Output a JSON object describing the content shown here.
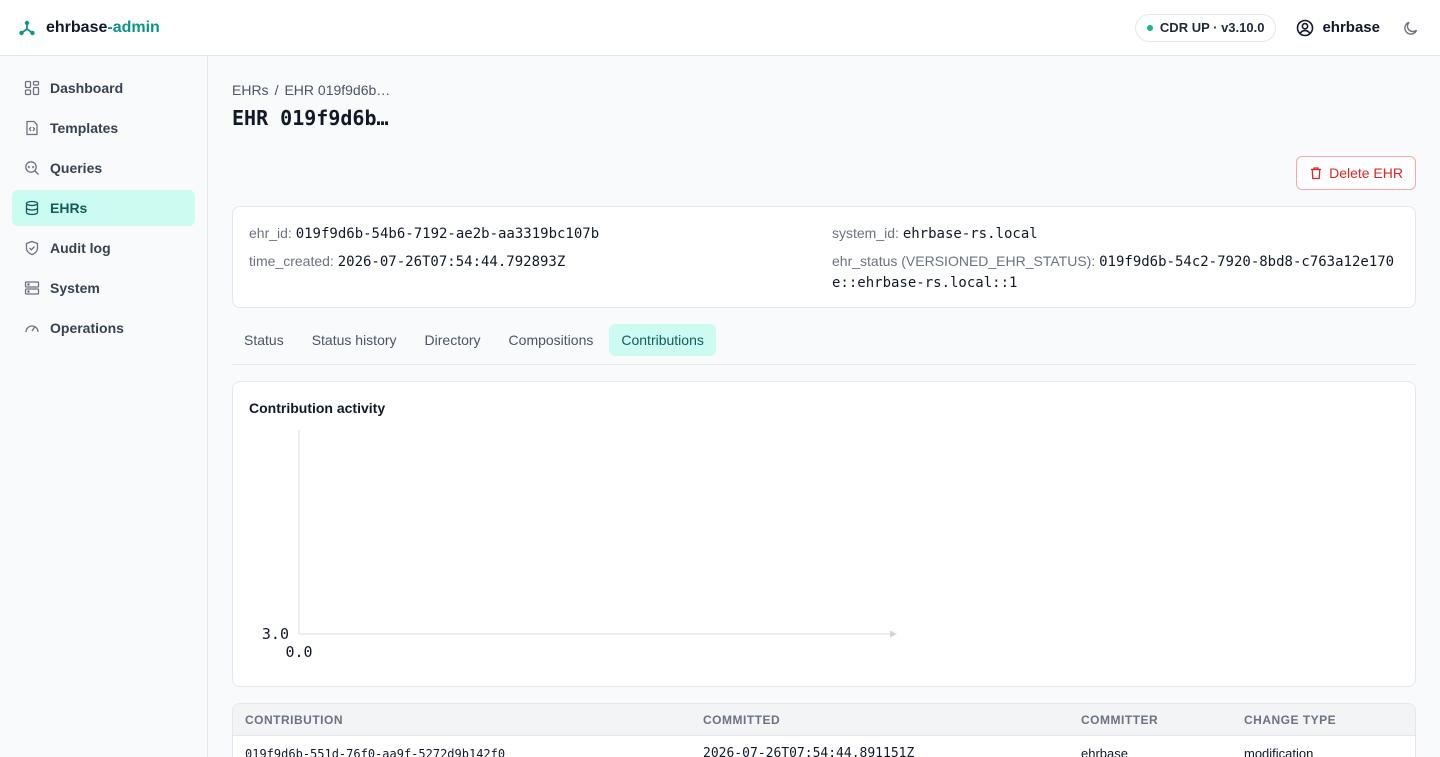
{
  "app": {
    "brand_main": "ehrbase",
    "brand_accent": "-admin",
    "status_pill": "CDR UP · v3.10.0",
    "username": "ehrbase"
  },
  "sidebar": {
    "items": [
      {
        "label": "Dashboard",
        "icon": "dashboard-icon"
      },
      {
        "label": "Templates",
        "icon": "template-icon"
      },
      {
        "label": "Queries",
        "icon": "query-icon"
      },
      {
        "label": "EHRs",
        "icon": "database-icon",
        "active": true
      },
      {
        "label": "Audit log",
        "icon": "shield-icon"
      },
      {
        "label": "System",
        "icon": "server-icon"
      },
      {
        "label": "Operations",
        "icon": "gauge-icon"
      }
    ]
  },
  "breadcrumb": {
    "root": "EHRs",
    "separator": "/",
    "current": "EHR 019f9d6b…"
  },
  "page": {
    "title": "EHR 019f9d6b…",
    "delete_label": "Delete EHR"
  },
  "ehr": {
    "ehr_id_label": "ehr_id:",
    "ehr_id": "019f9d6b-54b6-7192-ae2b-aa3319bc107b",
    "time_created_label": "time_created:",
    "time_created": "2026-07-26T07:54:44.792893Z",
    "system_id_label": "system_id:",
    "system_id": "ehrbase-rs.local",
    "ehr_status_label": "ehr_status (VERSIONED_EHR_STATUS):",
    "ehr_status_line1": "019f9d6b-54c2-7920-8bd8-c763a12e170",
    "ehr_status_line2": "e::ehrbase-rs.local::1"
  },
  "tabs": [
    {
      "label": "Status"
    },
    {
      "label": "Status history"
    },
    {
      "label": "Directory"
    },
    {
      "label": "Compositions"
    },
    {
      "label": "Contributions",
      "active": true
    }
  ],
  "chart_data": {
    "type": "bar",
    "title": "Contribution activity",
    "y_tick_label": "3.0",
    "x_tick_label": "0.0",
    "categories": [],
    "values": []
  },
  "table": {
    "headers": [
      "CONTRIBUTION",
      "COMMITTED",
      "COMMITTER",
      "CHANGE TYPE"
    ],
    "rows": [
      [
        "019f9d6b-551d-76f0-aa9f-5272d9b142f0",
        "2026-07-26T07:54:44.891151Z",
        "ehrbase",
        "modification"
      ]
    ]
  },
  "colors": {
    "accent": "#0d9488",
    "active_bg": "#ccfbf1",
    "danger": "#dc2626",
    "status_dot": "#10b981"
  }
}
